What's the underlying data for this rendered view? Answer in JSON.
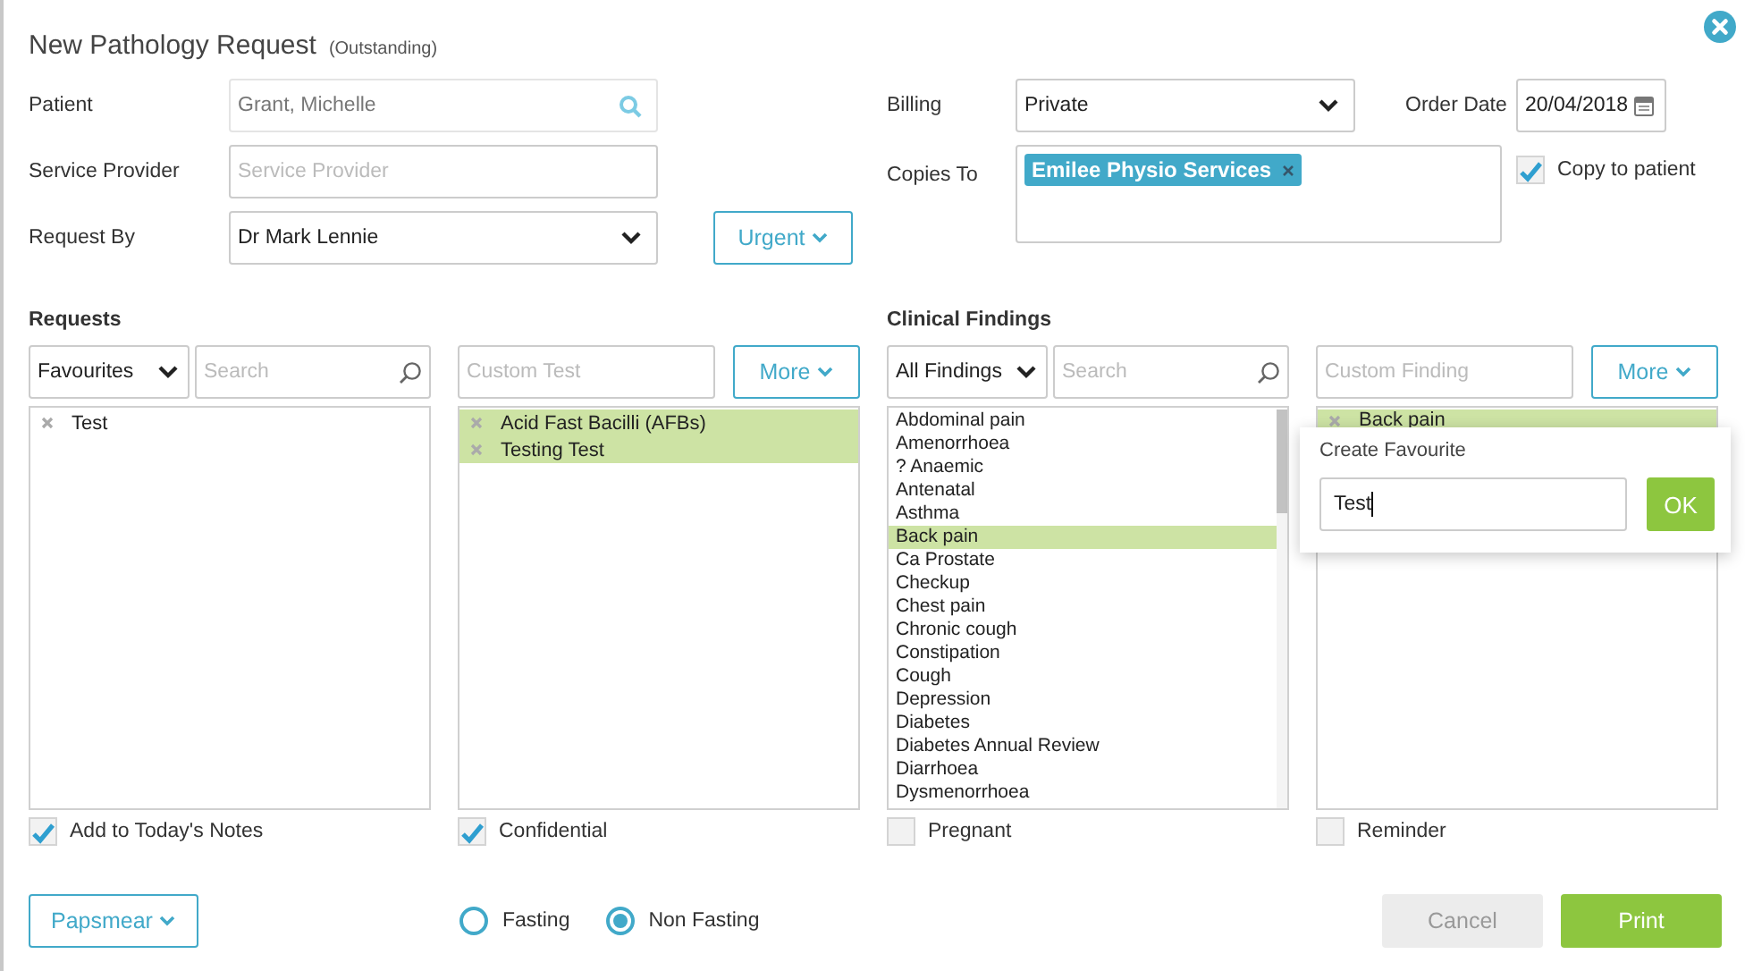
{
  "dialog": {
    "title": "New Pathology Request",
    "status": "(Outstanding)"
  },
  "form": {
    "patient": {
      "label": "Patient",
      "value": "Grant, Michelle"
    },
    "service_provider": {
      "label": "Service Provider",
      "placeholder": "Service Provider"
    },
    "request_by": {
      "label": "Request By",
      "value": "Dr Mark Lennie"
    },
    "urgent_button": "Urgent",
    "billing": {
      "label": "Billing",
      "value": "Private"
    },
    "order_date": {
      "label": "Order Date",
      "value": "20/04/2018"
    },
    "copies_to": {
      "label": "Copies To",
      "tags": [
        "Emilee Physio Services"
      ]
    },
    "copy_to_patient": {
      "label": "Copy to patient",
      "checked": true
    }
  },
  "requests": {
    "heading": "Requests",
    "filter": "Favourites",
    "search_placeholder": "Search",
    "custom_placeholder": "Custom Test",
    "more_button": "More",
    "favourites": [
      {
        "label": "Test",
        "selected": false
      }
    ],
    "chosen": [
      {
        "label": "Acid Fast Bacilli (AFBs)",
        "selected": true
      },
      {
        "label": "Testing Test",
        "selected": true
      }
    ],
    "options": [
      {
        "label": "Add to Today's Notes",
        "checked": true
      },
      {
        "label": "Confidential",
        "checked": true
      }
    ]
  },
  "clinical_findings": {
    "heading": "Clinical Findings",
    "filter": "All Findings",
    "search_placeholder": "Search",
    "custom_placeholder": "Custom Finding",
    "more_button": "More",
    "findings": [
      {
        "label": "Abdominal pain",
        "selected": false
      },
      {
        "label": "Amenorrhoea",
        "selected": false
      },
      {
        "label": "? Anaemic",
        "selected": false
      },
      {
        "label": "Antenatal",
        "selected": false
      },
      {
        "label": "Asthma",
        "selected": false
      },
      {
        "label": "Back pain",
        "selected": true
      },
      {
        "label": "Ca Prostate",
        "selected": false
      },
      {
        "label": "Checkup",
        "selected": false
      },
      {
        "label": "Chest pain",
        "selected": false
      },
      {
        "label": "Chronic cough",
        "selected": false
      },
      {
        "label": "Constipation",
        "selected": false
      },
      {
        "label": "Cough",
        "selected": false
      },
      {
        "label": "Depression",
        "selected": false
      },
      {
        "label": "Diabetes",
        "selected": false
      },
      {
        "label": "Diabetes Annual Review",
        "selected": false
      },
      {
        "label": "Diarrhoea",
        "selected": false
      },
      {
        "label": "Dysmenorrhoea",
        "selected": false
      }
    ],
    "chosen": [
      {
        "label": "Back pain",
        "selected": true
      }
    ],
    "options": [
      {
        "label": "Pregnant",
        "checked": false
      },
      {
        "label": "Reminder",
        "checked": false
      }
    ]
  },
  "popover": {
    "title": "Create Favourite",
    "value": "Test",
    "button": "OK"
  },
  "papsmear_button": "Papsmear",
  "fasting": [
    {
      "label": "Fasting",
      "selected": false
    },
    {
      "label": "Non Fasting",
      "selected": true
    }
  ],
  "buttons": [
    {
      "label": "Cancel",
      "kind": "secondary"
    },
    {
      "label": "Print",
      "kind": "primary"
    }
  ]
}
